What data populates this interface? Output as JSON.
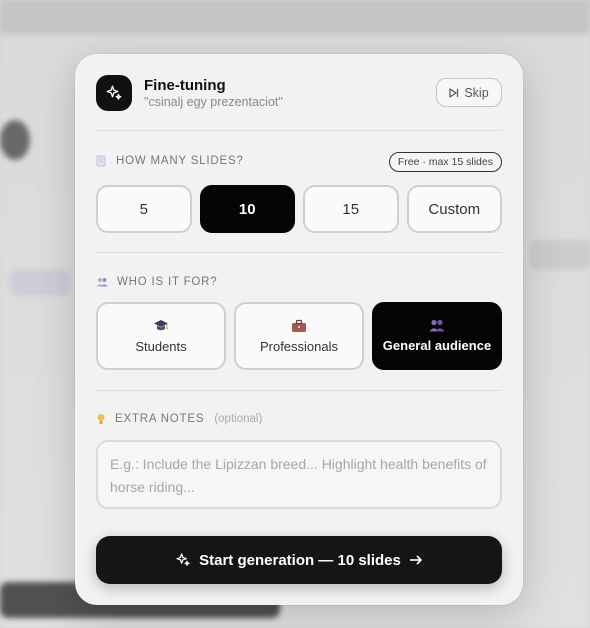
{
  "header": {
    "title": "Fine-tuning",
    "subtitle": "\"csinalj egy prezentaciot\"",
    "skip_label": "Skip"
  },
  "slides": {
    "label": "HOW MANY SLIDES?",
    "badge": "Free · max 15 slides",
    "options": [
      "5",
      "10",
      "15",
      "Custom"
    ],
    "selected": "10"
  },
  "audience": {
    "label": "WHO IS IT FOR?",
    "options": [
      {
        "label": "Students",
        "icon": "graduation-cap-icon"
      },
      {
        "label": "Professionals",
        "icon": "briefcase-icon"
      },
      {
        "label": "General audience",
        "icon": "people-icon"
      }
    ],
    "selected": "General audience"
  },
  "notes": {
    "label": "EXTRA NOTES",
    "optional": "(optional)",
    "placeholder": "E.g.: Include the Lipizzan breed... Highlight health benefits of horse riding..."
  },
  "start_button": {
    "label": "Start generation — 10 slides"
  },
  "colors": {
    "accent": "#050505",
    "modal_bg": "#f2f2f2",
    "people_icon": "#7b5ea7"
  }
}
